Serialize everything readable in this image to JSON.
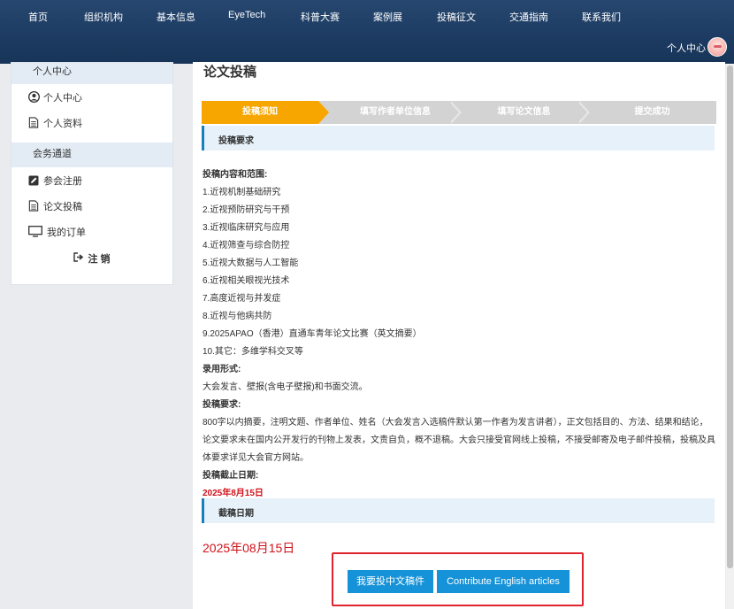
{
  "nav": {
    "items": [
      "首页",
      "组织机构",
      "基本信息",
      "EyeTech",
      "科普大赛",
      "案例展",
      "投稿征文",
      "交通指南",
      "联系我们"
    ],
    "user_center": "个人中心"
  },
  "sidebar": {
    "section1": "个人中心",
    "items1": [
      {
        "label": "个人中心",
        "icon": "user-circle-icon"
      },
      {
        "label": "个人资料",
        "icon": "document-icon"
      }
    ],
    "section2": "会务通道",
    "items2": [
      {
        "label": "参会注册",
        "icon": "edit-icon"
      },
      {
        "label": "论文投稿",
        "icon": "document-icon"
      },
      {
        "label": "我的订单",
        "icon": "monitor-icon"
      }
    ],
    "logout": "注 销"
  },
  "main": {
    "title": "论文投稿",
    "steps": [
      "投稿须知",
      "填写作者单位信息",
      "填写论文信息",
      "提交成功"
    ],
    "section_requirements": "投稿要求",
    "scope_title": "投稿内容和范围:",
    "scope_items": [
      "1.近视机制基础研究",
      "2.近视预防研究与干预",
      "3.近视临床研究与应用",
      "4.近视筛查与综合防控",
      "5.近视大数据与人工智能",
      "6.近视相关眼视光技术",
      "7.高度近视与并发症",
      "8.近视与他病共防",
      "9.2025APAO（香港）直通车青年论文比赛（英文摘要）",
      "10.其它：多维学科交叉等"
    ],
    "format_title": "录用形式:",
    "format_text": "大会发言、壁报(含电子壁报)和书面交流。",
    "req_title": "投稿要求:",
    "req_text": "800字以内摘要，注明文题、作者单位、姓名（大会发言入选稿件默认第一作者为发言讲者），正文包括目的、方法、结果和结论，论文要求未在国内公开发行的刊物上发表，文责自负，概不退稿。大会只接受官网线上投稿，不接受邮寄及电子邮件投稿，投稿及具体要求详见大会官方网站。",
    "deadline_title": "投稿截止日期:",
    "deadline_value": "2025年8月15日",
    "section_deadline": "截稿日期",
    "deadline_big": "2025年08月15日",
    "btn_cn": "我要投中文稿件",
    "btn_en": "Contribute English articles"
  },
  "colors": {
    "nav_bg": "#1d3b62",
    "step_active": "#f7a600",
    "accent_blue": "#1592d8",
    "deadline_red": "#d0121b",
    "highlight_frame": "#e0232d"
  }
}
